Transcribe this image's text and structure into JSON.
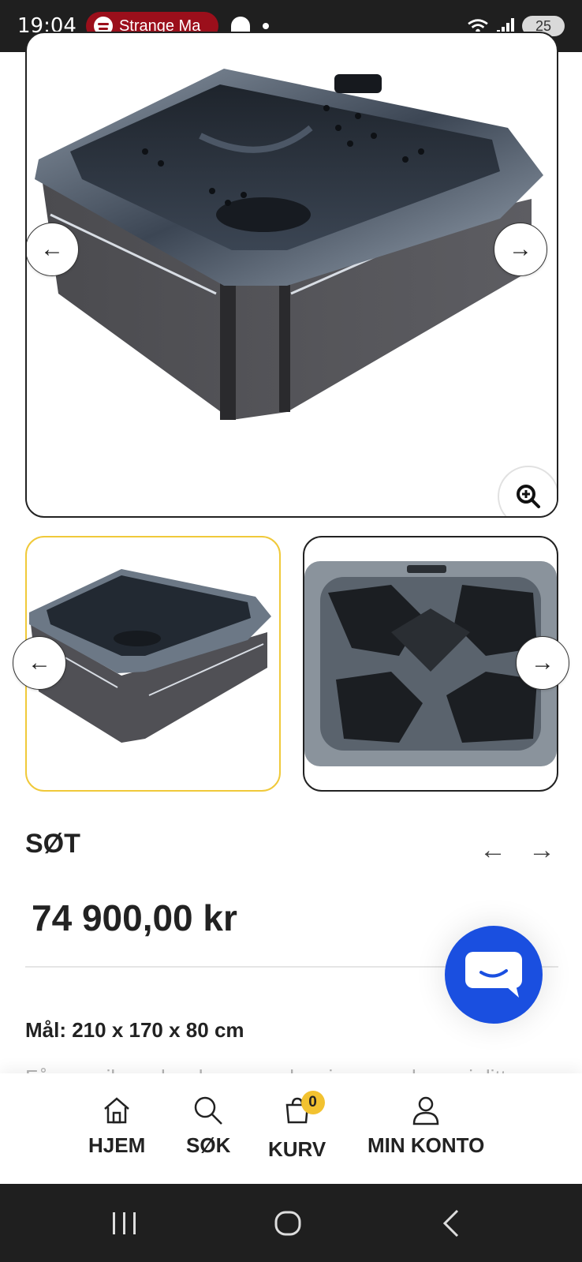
{
  "status_bar": {
    "time": "19:04",
    "media_text": "Strange Ma",
    "battery": "25"
  },
  "gallery": {
    "prev_arrow": "←",
    "next_arrow": "→"
  },
  "product": {
    "title": "SØT",
    "price": "74 900,00 kr",
    "dimensions": "Mål: 210 x 170 x 80 cm",
    "description_preview": "Få en unik opplevelse av avslapning og velvære i ditt",
    "prev_product": "←",
    "next_product": "→"
  },
  "bottom_nav": {
    "items": [
      {
        "label": "HJEM",
        "icon": "home-icon"
      },
      {
        "label": "SØK",
        "icon": "search-icon"
      },
      {
        "label": "KURV",
        "icon": "cart-icon",
        "badge": "0"
      },
      {
        "label": "MIN KONTO",
        "icon": "user-icon"
      }
    ]
  },
  "colors": {
    "accent_yellow": "#f2c230",
    "chat_blue": "#1a4fe0",
    "system_bar": "#1f1f1f"
  }
}
